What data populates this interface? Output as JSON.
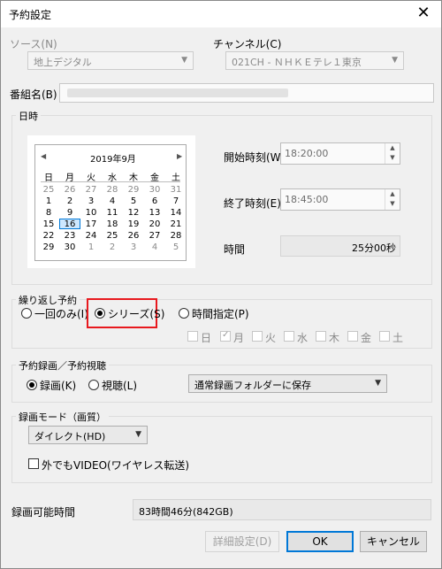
{
  "window": {
    "title": "予約設定",
    "close_glyph": "✕"
  },
  "source": {
    "label": "ソース(N)",
    "value": "地上デジタル"
  },
  "channel": {
    "label": "チャンネル(C)",
    "value": "021CH - ＮＨＫＥテレ１東京"
  },
  "program": {
    "label": "番組名(B)"
  },
  "datetime": {
    "group_title": "日時",
    "calendar": {
      "month_label": "2019年9月",
      "prev": "◀",
      "next": "▶",
      "weekdays": [
        "日",
        "月",
        "火",
        "水",
        "木",
        "金",
        "土"
      ],
      "rows": [
        [
          "25",
          "26",
          "27",
          "28",
          "29",
          "30",
          "31"
        ],
        [
          "1",
          "2",
          "3",
          "4",
          "5",
          "6",
          "7"
        ],
        [
          "8",
          "9",
          "10",
          "11",
          "12",
          "13",
          "14"
        ],
        [
          "15",
          "16",
          "17",
          "18",
          "19",
          "20",
          "21"
        ],
        [
          "22",
          "23",
          "24",
          "25",
          "26",
          "27",
          "28"
        ],
        [
          "29",
          "30",
          "1",
          "2",
          "3",
          "4",
          "5"
        ]
      ],
      "selected_day": "16"
    },
    "start": {
      "label": "開始時刻(W)",
      "value": "18:20:00"
    },
    "end": {
      "label": "終了時刻(E)",
      "value": "18:45:00"
    },
    "duration": {
      "label": "時間",
      "value": "25分00秒"
    }
  },
  "repeat": {
    "group_title": "繰り返し予約",
    "options": [
      {
        "label": "一回のみ(I)",
        "selected": false
      },
      {
        "label": "シリーズ(S)",
        "selected": true
      },
      {
        "label": "時間指定(P)",
        "selected": false
      }
    ],
    "days": [
      {
        "label": "日",
        "checked": false
      },
      {
        "label": "月",
        "checked": true
      },
      {
        "label": "火",
        "checked": false
      },
      {
        "label": "水",
        "checked": false
      },
      {
        "label": "木",
        "checked": false
      },
      {
        "label": "金",
        "checked": false
      },
      {
        "label": "土",
        "checked": false
      }
    ],
    "highlight_color": "#e8191e"
  },
  "record_type": {
    "group_title": "予約録画／予約視聴",
    "options": [
      {
        "label": "録画(K)",
        "selected": true
      },
      {
        "label": "視聴(L)",
        "selected": false
      }
    ],
    "folder": "通常録画フォルダーに保存"
  },
  "mode": {
    "group_title": "録画モード（画質）",
    "value": "ダイレクト(HD)",
    "wireless_label": "外でもVIDEO(ワイヤレス転送)",
    "wireless_checked": false
  },
  "available": {
    "label": "録画可能時間",
    "value": "83時間46分(842GB)"
  },
  "buttons": {
    "details": "詳細設定(D)",
    "ok": "OK",
    "cancel": "キャンセル"
  },
  "colors": {
    "accent": "#0078d7",
    "dialog_bg": "#f0f0f0"
  }
}
